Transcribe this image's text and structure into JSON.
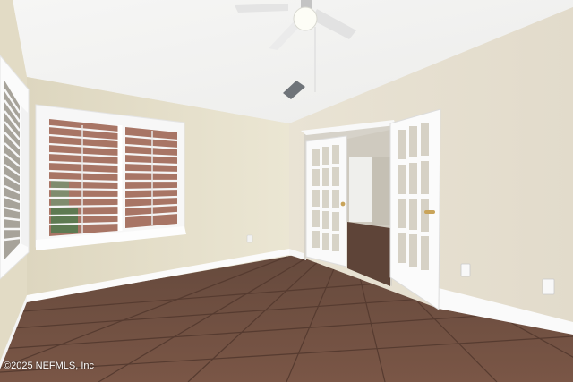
{
  "watermark": {
    "text": "©2025 NEFMLS, Inc"
  },
  "colors": {
    "ceiling": "#f4f4f3",
    "left_wall": "#e8e2cd",
    "right_wall": "#e6e0d1",
    "floor": "#6f4f40",
    "grout": "#5b3f33",
    "baseboard": "#fbfbfb",
    "shutter": "#f6f6f6",
    "brick": "#a26f5e",
    "door_glass": "#d9d4c6",
    "hallway": "#d7d3cc"
  },
  "icons": {
    "ceiling_fan": "ceiling-fan-icon",
    "air_vent": "air-vent-icon",
    "outlet": "electrical-outlet-icon",
    "door_handle": "door-handle-icon"
  }
}
